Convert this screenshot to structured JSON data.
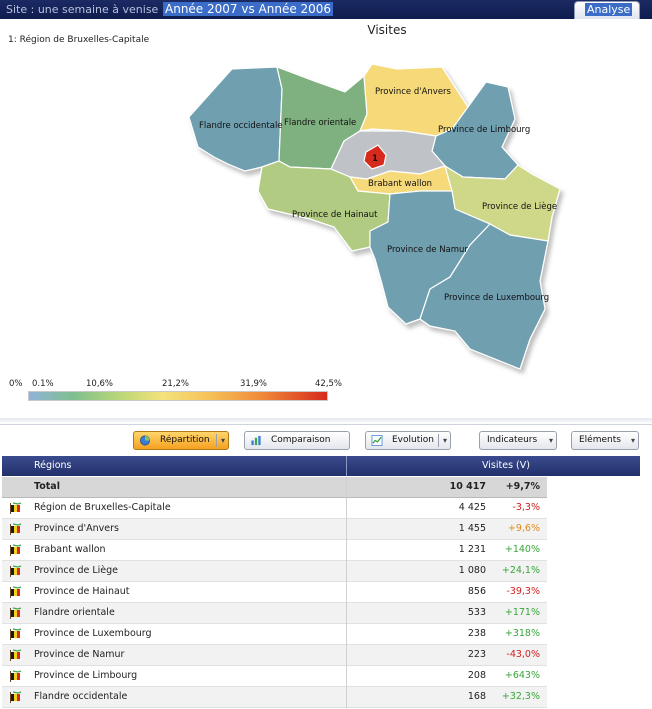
{
  "topbar": {
    "site_label": "Site : une semaine à venise",
    "compare_label": "Année 2007 vs Année 2006",
    "tab_label": "Analyse"
  },
  "map": {
    "title": "Visites",
    "selected_region": "1: Région de Bruxelles-Capitale",
    "marker": "1",
    "regions": [
      {
        "name": "Flandre occidentale",
        "color": "#6f9fb0"
      },
      {
        "name": "Flandre orientale",
        "color": "#7fb07f"
      },
      {
        "name": "Province d'Anvers",
        "color": "#f6d978"
      },
      {
        "name": "Province de Limbourg",
        "color": "#6f9fb0"
      },
      {
        "name": "Brabant wallon",
        "color": "#f6d978"
      },
      {
        "name": "Province de Hainaut",
        "color": "#b2cb82"
      },
      {
        "name": "Province de Liège",
        "color": "#cfd889"
      },
      {
        "name": "Province de Namur",
        "color": "#6f9fb0"
      },
      {
        "name": "Province de Luxembourg",
        "color": "#6f9fb0"
      }
    ],
    "brabant_flamand_color": "#bfc3c7",
    "bruxelles_color": "#d62a1d"
  },
  "legend": {
    "ticks": [
      "0%",
      "0.1%",
      "10,6%",
      "21,2%",
      "31,9%",
      "42,5%"
    ]
  },
  "toolbar": {
    "repartition": "Répartition",
    "comparaison": "Comparaison",
    "evolution": "Evolution",
    "indicateurs": "Indicateurs",
    "elements": "Eléments"
  },
  "table": {
    "col_regions": "Régions",
    "col_visites": "Visites (V)",
    "total": {
      "label": "Total",
      "value": "10 417",
      "pct": "+9,7%"
    },
    "rows": [
      {
        "name": "Région de Bruxelles-Capitale",
        "value": "4 425",
        "pct": "-3,3%",
        "trend": "neg"
      },
      {
        "name": "Province d'Anvers",
        "value": "1 455",
        "pct": "+9,6%",
        "trend": "neu"
      },
      {
        "name": "Brabant wallon",
        "value": "1 231",
        "pct": "+140%",
        "trend": "pos"
      },
      {
        "name": "Province de Liège",
        "value": "1 080",
        "pct": "+24,1%",
        "trend": "pos"
      },
      {
        "name": "Province de Hainaut",
        "value": "856",
        "pct": "-39,3%",
        "trend": "neg"
      },
      {
        "name": "Flandre orientale",
        "value": "533",
        "pct": "+171%",
        "trend": "pos"
      },
      {
        "name": "Province de Luxembourg",
        "value": "238",
        "pct": "+318%",
        "trend": "pos"
      },
      {
        "name": "Province de Namur",
        "value": "223",
        "pct": "-43,0%",
        "trend": "neg"
      },
      {
        "name": "Province de Limbourg",
        "value": "208",
        "pct": "+643%",
        "trend": "pos"
      },
      {
        "name": "Flandre occidentale",
        "value": "168",
        "pct": "+32,3%",
        "trend": "pos"
      }
    ]
  }
}
